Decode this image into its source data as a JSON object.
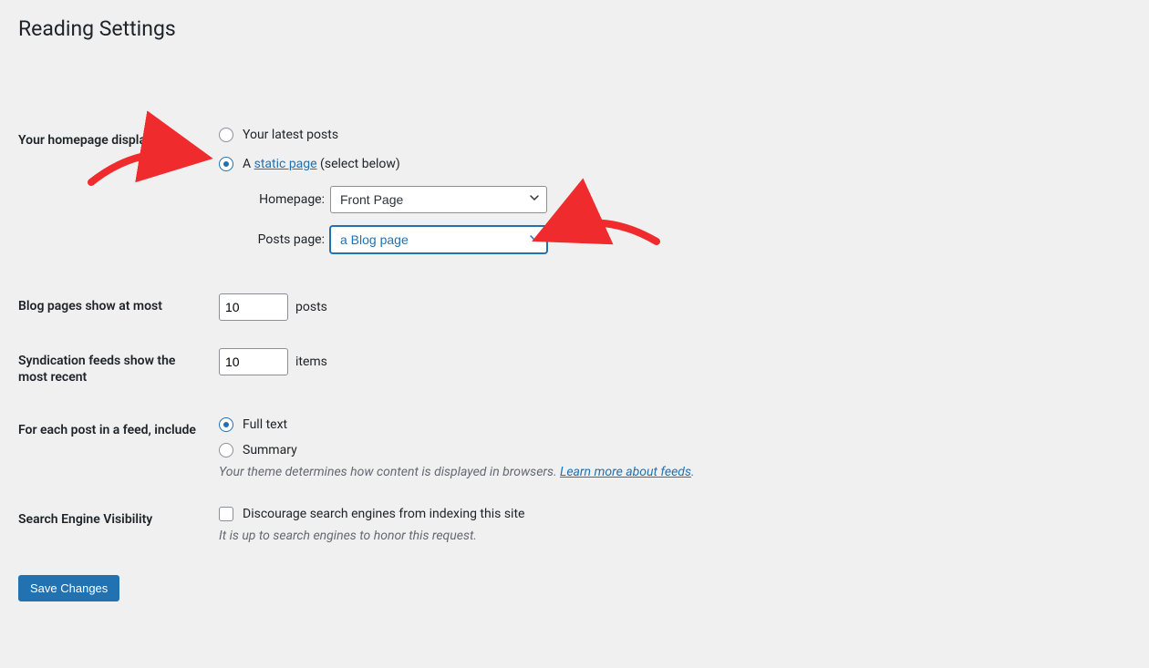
{
  "page": {
    "title": "Reading Settings"
  },
  "homepage_displays": {
    "heading": "Your homepage displays",
    "option_latest": "Your latest posts",
    "option_static_prefix": "A ",
    "option_static_link": "static page",
    "option_static_suffix": " (select below)",
    "homepage_label": "Homepage:",
    "homepage_select_value": "Front Page",
    "posts_page_label": "Posts page:",
    "posts_page_select_value": "a Blog page"
  },
  "blog_pages": {
    "heading": "Blog pages show at most",
    "value": "10",
    "unit": "posts"
  },
  "syndication": {
    "heading": "Syndication feeds show the most recent",
    "value": "10",
    "unit": "items"
  },
  "feed_content": {
    "heading": "For each post in a feed, include",
    "option_full": "Full text",
    "option_summary": "Summary",
    "desc_prefix": "Your theme determines how content is displayed in browsers. ",
    "desc_link": "Learn more about feeds",
    "desc_suffix": "."
  },
  "search_visibility": {
    "heading": "Search Engine Visibility",
    "checkbox_label": "Discourage search engines from indexing this site",
    "description": "It is up to search engines to honor this request."
  },
  "submit": {
    "label": "Save Changes"
  }
}
